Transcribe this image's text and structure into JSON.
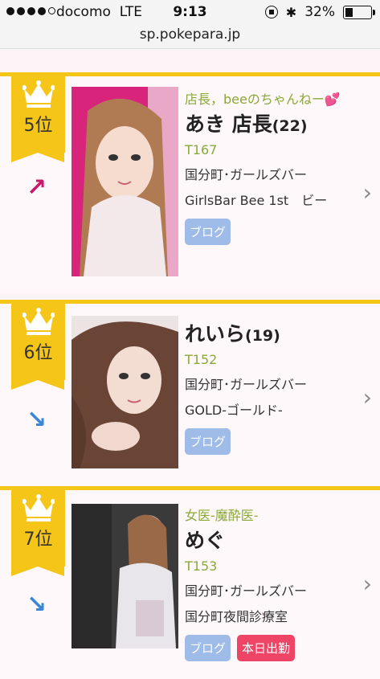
{
  "status": {
    "signal_filled": 4,
    "signal_total": 5,
    "carrier": "docomo",
    "network": "LTE",
    "time": "9:13",
    "battery_text": "32%",
    "battery_level": 0.32
  },
  "url": "sp.pokepara.jp",
  "colors": {
    "accent": "#f5c518",
    "tag_green": "#8aa83a",
    "blog_btn": "#9fbbe7",
    "work_btn": "#ee4466",
    "trend_up": "#c9186b",
    "trend_down": "#3a86d8"
  },
  "entries": [
    {
      "rank": "5位",
      "trend": "up",
      "tagline": "店長，beeのちゃんねー💕",
      "name": "あき 店長",
      "age": "(22)",
      "height": "T167",
      "area": "国分町･ガールズバー",
      "shop": "GirlsBar Bee 1st　ビー",
      "blog": "ブログ",
      "work": ""
    },
    {
      "rank": "6位",
      "trend": "down",
      "tagline": "",
      "name": "れいら",
      "age": "(19)",
      "height": "T152",
      "area": "国分町･ガールズバー",
      "shop": "GOLD-ゴールド-",
      "blog": "ブログ",
      "work": ""
    },
    {
      "rank": "7位",
      "trend": "down",
      "tagline": "女医-魔酔医-",
      "name": "めぐ",
      "age": "",
      "height": "T153",
      "area": "国分町･ガールズバー",
      "shop": "国分町夜間診療室",
      "blog": "ブログ",
      "work": "本日出勤"
    }
  ]
}
